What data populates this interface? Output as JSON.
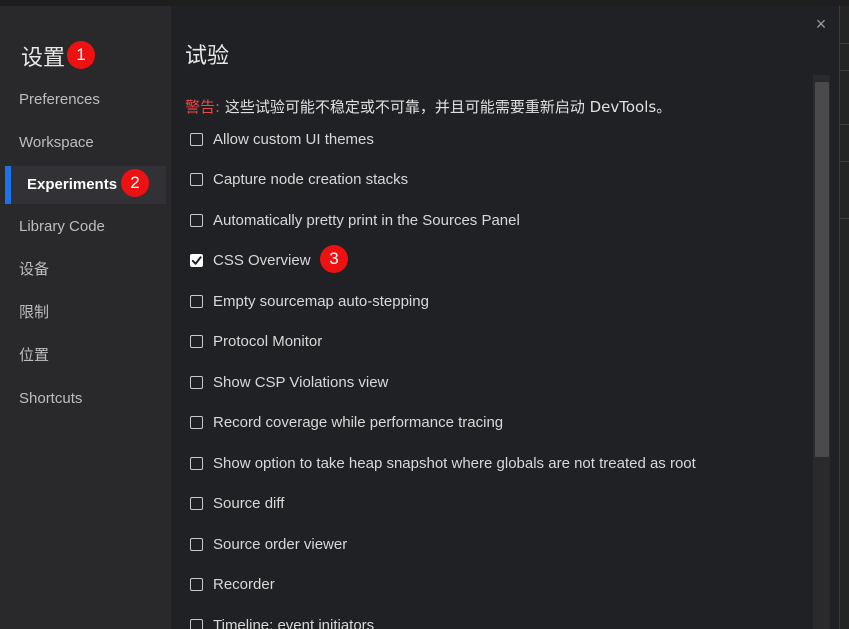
{
  "dialog": {
    "close_glyph": "×"
  },
  "sidebar": {
    "title": "设置",
    "items": [
      {
        "label": "Preferences",
        "active": false
      },
      {
        "label": "Workspace",
        "active": false
      },
      {
        "label": "Experiments",
        "active": true
      },
      {
        "label": "Library Code",
        "active": false
      },
      {
        "label": "设备",
        "active": false
      },
      {
        "label": "限制",
        "active": false
      },
      {
        "label": "位置",
        "active": false
      },
      {
        "label": "Shortcuts",
        "active": false
      }
    ]
  },
  "content": {
    "title": "试验",
    "warning_label": "警告:",
    "warning_text": " 这些试验可能不稳定或不可靠，并且可能需要重新启动 DevTools。",
    "experiments": [
      {
        "label": "Allow custom UI themes",
        "checked": false
      },
      {
        "label": "Capture node creation stacks",
        "checked": false
      },
      {
        "label": "Automatically pretty print in the Sources Panel",
        "checked": false
      },
      {
        "label": "CSS Overview",
        "checked": true
      },
      {
        "label": "Empty sourcemap auto-stepping",
        "checked": false
      },
      {
        "label": "Protocol Monitor",
        "checked": false
      },
      {
        "label": "Show CSP Violations view",
        "checked": false
      },
      {
        "label": "Record coverage while performance tracing",
        "checked": false
      },
      {
        "label": "Show option to take heap snapshot where globals are not treated as root",
        "checked": false
      },
      {
        "label": "Source diff",
        "checked": false
      },
      {
        "label": "Source order viewer",
        "checked": false
      },
      {
        "label": "Recorder",
        "checked": false
      },
      {
        "label": "Timeline: event initiators",
        "checked": false
      }
    ]
  },
  "annotations": [
    {
      "number": "1"
    },
    {
      "number": "2"
    },
    {
      "number": "3"
    }
  ],
  "colors": {
    "accent": "#1a73e8",
    "badge": "#ee1111",
    "warning": "#e84a4a",
    "background": "#202124",
    "sidebar": "#29292b"
  }
}
